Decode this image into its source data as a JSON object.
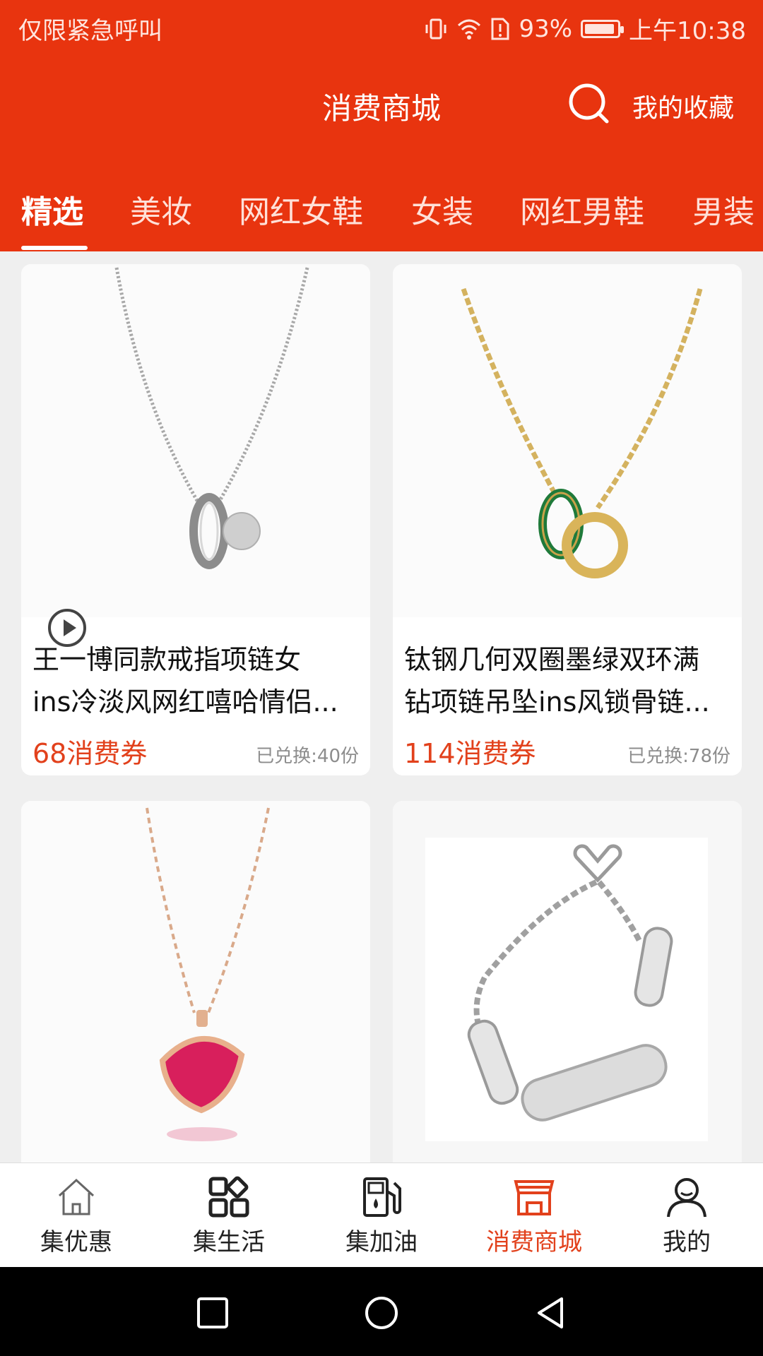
{
  "status_bar": {
    "left_text": "仅限紧急呼叫",
    "battery": "93%",
    "battery_level": 0.93,
    "time": "上午10:38"
  },
  "header": {
    "title": "消费商城",
    "favorites_label": "我的收藏"
  },
  "tabs": [
    {
      "label": "精选",
      "active": true
    },
    {
      "label": "美妆",
      "active": false
    },
    {
      "label": "网红女鞋",
      "active": false
    },
    {
      "label": "女装",
      "active": false
    },
    {
      "label": "网红男鞋",
      "active": false
    },
    {
      "label": "男装",
      "active": false
    }
  ],
  "products": [
    {
      "title_line1": "王一博同款戒指项链女",
      "title_line2": "ins冷淡风网红嘻哈情侣...",
      "price": "68消费券",
      "sold": "已兑换:40份",
      "image": "silver-ring-necklace"
    },
    {
      "title_line1": "钛钢几何双圈墨绿双环满",
      "title_line2": "钻项链吊坠ins风锁骨链...",
      "price": "114消费券",
      "sold": "已兑换:78份",
      "image": "gold-double-ring-necklace"
    },
    {
      "title_line1": "",
      "title_line2": "",
      "price": "",
      "sold": "",
      "image": "rose-gold-red-gem-necklace"
    },
    {
      "title_line1": "",
      "title_line2": "",
      "price": "",
      "sold": "",
      "image": "silver-paris-bracelet"
    }
  ],
  "bottom_nav": [
    {
      "label": "集优惠",
      "icon": "home-icon",
      "active": false
    },
    {
      "label": "集生活",
      "icon": "apps-grid-icon",
      "active": false
    },
    {
      "label": "集加油",
      "icon": "fuel-pump-icon",
      "active": false
    },
    {
      "label": "消费商城",
      "icon": "store-icon",
      "active": true
    },
    {
      "label": "我的",
      "icon": "user-icon",
      "active": false
    }
  ],
  "colors": {
    "brand": "#e8340f",
    "price": "#e2411c",
    "background": "#efefef"
  }
}
